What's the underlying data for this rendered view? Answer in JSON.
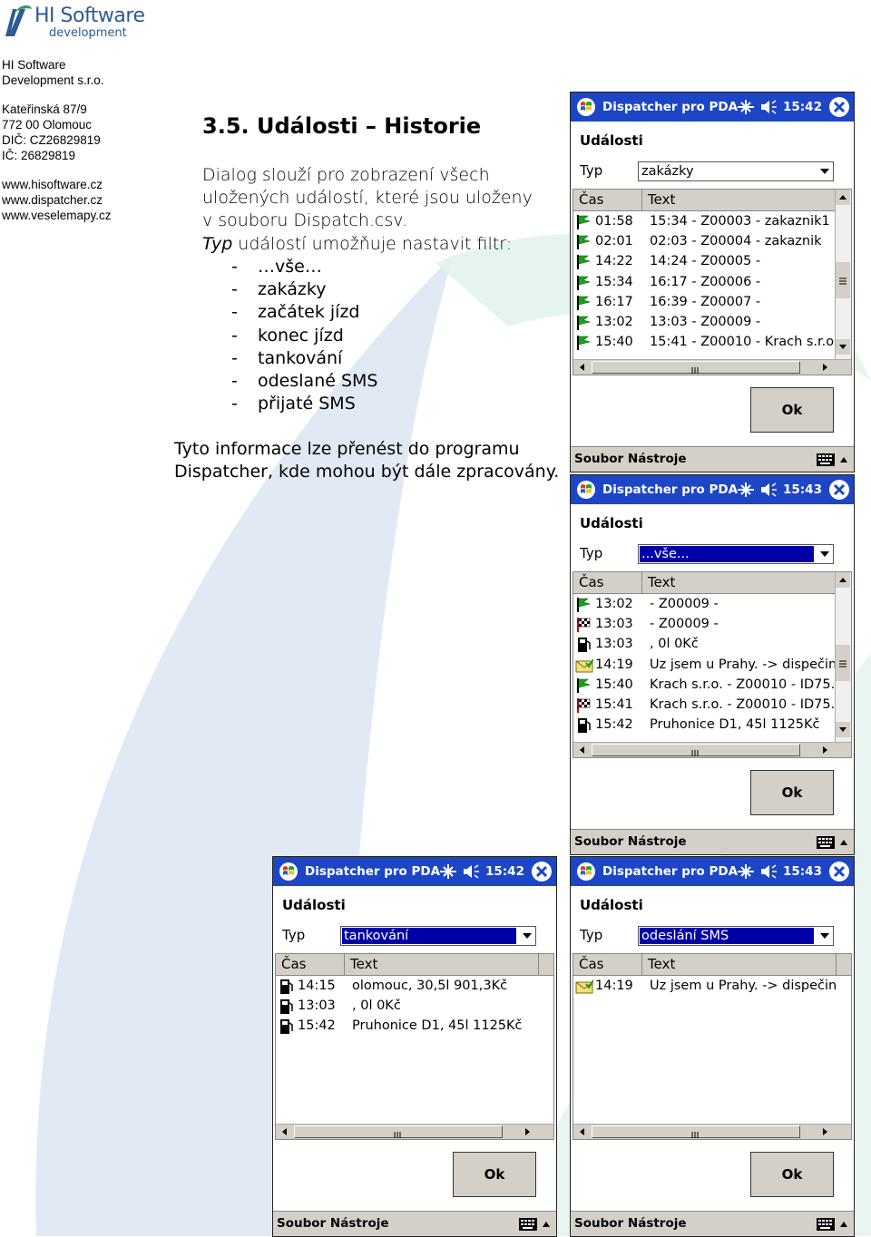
{
  "company": {
    "logo_main": "HI Software",
    "logo_sub": "development",
    "contact_lines": [
      "HI Software",
      "Development s.r.o."
    ],
    "address_lines": [
      "Kateřinská 87/9",
      "772 00 Olomouc",
      "DIČ: CZ26829819",
      "IČ: 26829819"
    ],
    "web_lines": [
      "www.hisoftware.cz",
      "www.dispatcher.cz",
      "www.veselemapy.cz"
    ]
  },
  "section": {
    "heading": "3.5.  Události – Historie",
    "intro_lines": [
      "Dialog slouží pro zobrazení všech",
      "uložených událostí, které jsou uloženy",
      "v souboru Dispatch.csv."
    ],
    "typ_word": "Typ",
    "typ_rest": " událostí umožňuje nastavit filtr:",
    "bullet_dash": "-",
    "bullets": [
      "…vše…",
      "zakázky",
      "začátek jízd",
      "konec jízd",
      "tankování",
      "odeslané SMS",
      "přijaté SMS"
    ],
    "outro_lines": [
      "Tyto informace lze přenést do programu",
      "Dispatcher, kde mohou být dále zpracovány."
    ]
  },
  "screens": [
    {
      "title": "Dispatcher pro PDA",
      "time": "15:42",
      "caption": "Události",
      "typ_label": "Typ",
      "typ_value": "zakázky",
      "col_time": "Čas",
      "col_text": "Text",
      "rows": [
        {
          "icon": "flag-green-icon",
          "time": "01:58",
          "text": "15:34 - Z00003 - zakaznik1"
        },
        {
          "icon": "flag-green-icon",
          "time": "02:01",
          "text": "02:03 - Z00004 - zakaznik"
        },
        {
          "icon": "flag-green-icon",
          "time": "14:22",
          "text": "14:24 - Z00005 -"
        },
        {
          "icon": "flag-green-icon",
          "time": "15:34",
          "text": "16:17 - Z00006 -"
        },
        {
          "icon": "flag-green-icon",
          "time": "16:17",
          "text": "16:39 - Z00007 -"
        },
        {
          "icon": "flag-green-icon",
          "time": "13:02",
          "text": "13:03 - Z00009 -"
        },
        {
          "icon": "flag-green-icon",
          "time": "15:40",
          "text": "15:41 - Z00010 - Krach s.r.o"
        }
      ],
      "ok": "Ok",
      "menu": "Soubor  Nástroje"
    },
    {
      "title": "Dispatcher pro PDA",
      "time": "15:43",
      "caption": "Události",
      "typ_label": "Typ",
      "typ_value": "...vše...",
      "col_time": "Čas",
      "col_text": "Text",
      "rows": [
        {
          "icon": "flag-green-icon",
          "time": "13:02",
          "text": " - Z00009 -"
        },
        {
          "icon": "flag-checkered-icon",
          "time": "13:03",
          "text": " - Z00009 -"
        },
        {
          "icon": "fuel-pump-icon",
          "time": "13:03",
          "text": ", 0l 0Kč"
        },
        {
          "icon": "envelope-icon",
          "time": "14:19",
          "text": "Uz jsem u Prahy. -> dispečink"
        },
        {
          "icon": "flag-green-icon",
          "time": "15:40",
          "text": "Krach s.r.o. - Z00010 - ID75."
        },
        {
          "icon": "flag-checkered-icon",
          "time": "15:41",
          "text": "Krach s.r.o. - Z00010 - ID75."
        },
        {
          "icon": "fuel-pump-icon",
          "time": "15:42",
          "text": "Pruhonice D1, 45l 1125Kč"
        }
      ],
      "ok": "Ok",
      "menu": "Soubor  Nástroje"
    },
    {
      "title": "Dispatcher pro PDA",
      "time": "15:42",
      "caption": "Události",
      "typ_label": "Typ",
      "typ_value": "tankování",
      "col_time": "Čas",
      "col_text": "Text",
      "rows": [
        {
          "icon": "fuel-pump-icon",
          "time": "14:15",
          "text": "olomouc, 30,5l 901,3Kč"
        },
        {
          "icon": "fuel-pump-icon",
          "time": "13:03",
          "text": ", 0l 0Kč"
        },
        {
          "icon": "fuel-pump-icon",
          "time": "15:42",
          "text": "Pruhonice D1, 45l 1125Kč"
        }
      ],
      "ok": "Ok",
      "menu": "Soubor  Nástroje"
    },
    {
      "title": "Dispatcher pro PDA",
      "time": "15:43",
      "caption": "Události",
      "typ_label": "Typ",
      "typ_value": "odeslání SMS",
      "col_time": "Čas",
      "col_text": "Text",
      "rows": [
        {
          "icon": "envelope-icon",
          "time": "14:19",
          "text": "Uz jsem u Prahy. -> dispečink"
        }
      ],
      "ok": "Ok",
      "menu": "Soubor  Nástroje"
    }
  ],
  "colors": {
    "titlebar": "#1c46c6",
    "selection": "#0000a8",
    "logo": "#2a5b93",
    "watermark_blue": "#dce6f2",
    "watermark_green": "#e3f3ec"
  }
}
